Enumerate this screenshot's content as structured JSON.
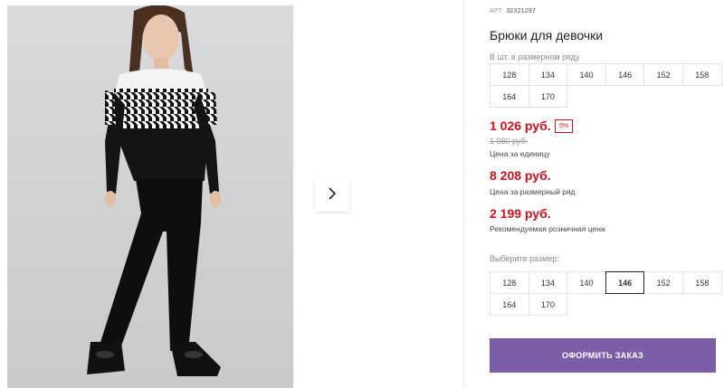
{
  "gallery": {
    "next_icon": "chevron-right-icon"
  },
  "product": {
    "sku_label": "АРТ:",
    "sku_value": "32321297",
    "title": "Брюки для девочки"
  },
  "size_range": {
    "hint": "В шт. в размерном ряду",
    "sizes": [
      "128",
      "134",
      "140",
      "146",
      "152",
      "158",
      "164",
      "170"
    ]
  },
  "prices": {
    "unit_price": "1 026 руб.",
    "discount_badge": "5%",
    "old_price": "1 080 руб.",
    "unit_caption": "Цена за единицу",
    "range_price": "8 208 руб.",
    "range_caption": "Цена за размерный ряд",
    "retail_price": "2 199 руб.",
    "retail_caption": "Рекомендуемая розничная цена"
  },
  "size_select": {
    "hint": "Выберите размер:",
    "sizes": [
      "128",
      "134",
      "140",
      "146",
      "152",
      "158",
      "164",
      "170"
    ],
    "selected": "146"
  },
  "actions": {
    "order_label": "ОФОРМИТЬ ЗАКАЗ"
  },
  "colors": {
    "accent": "#7b5ea7",
    "price_red": "#d0101b"
  }
}
